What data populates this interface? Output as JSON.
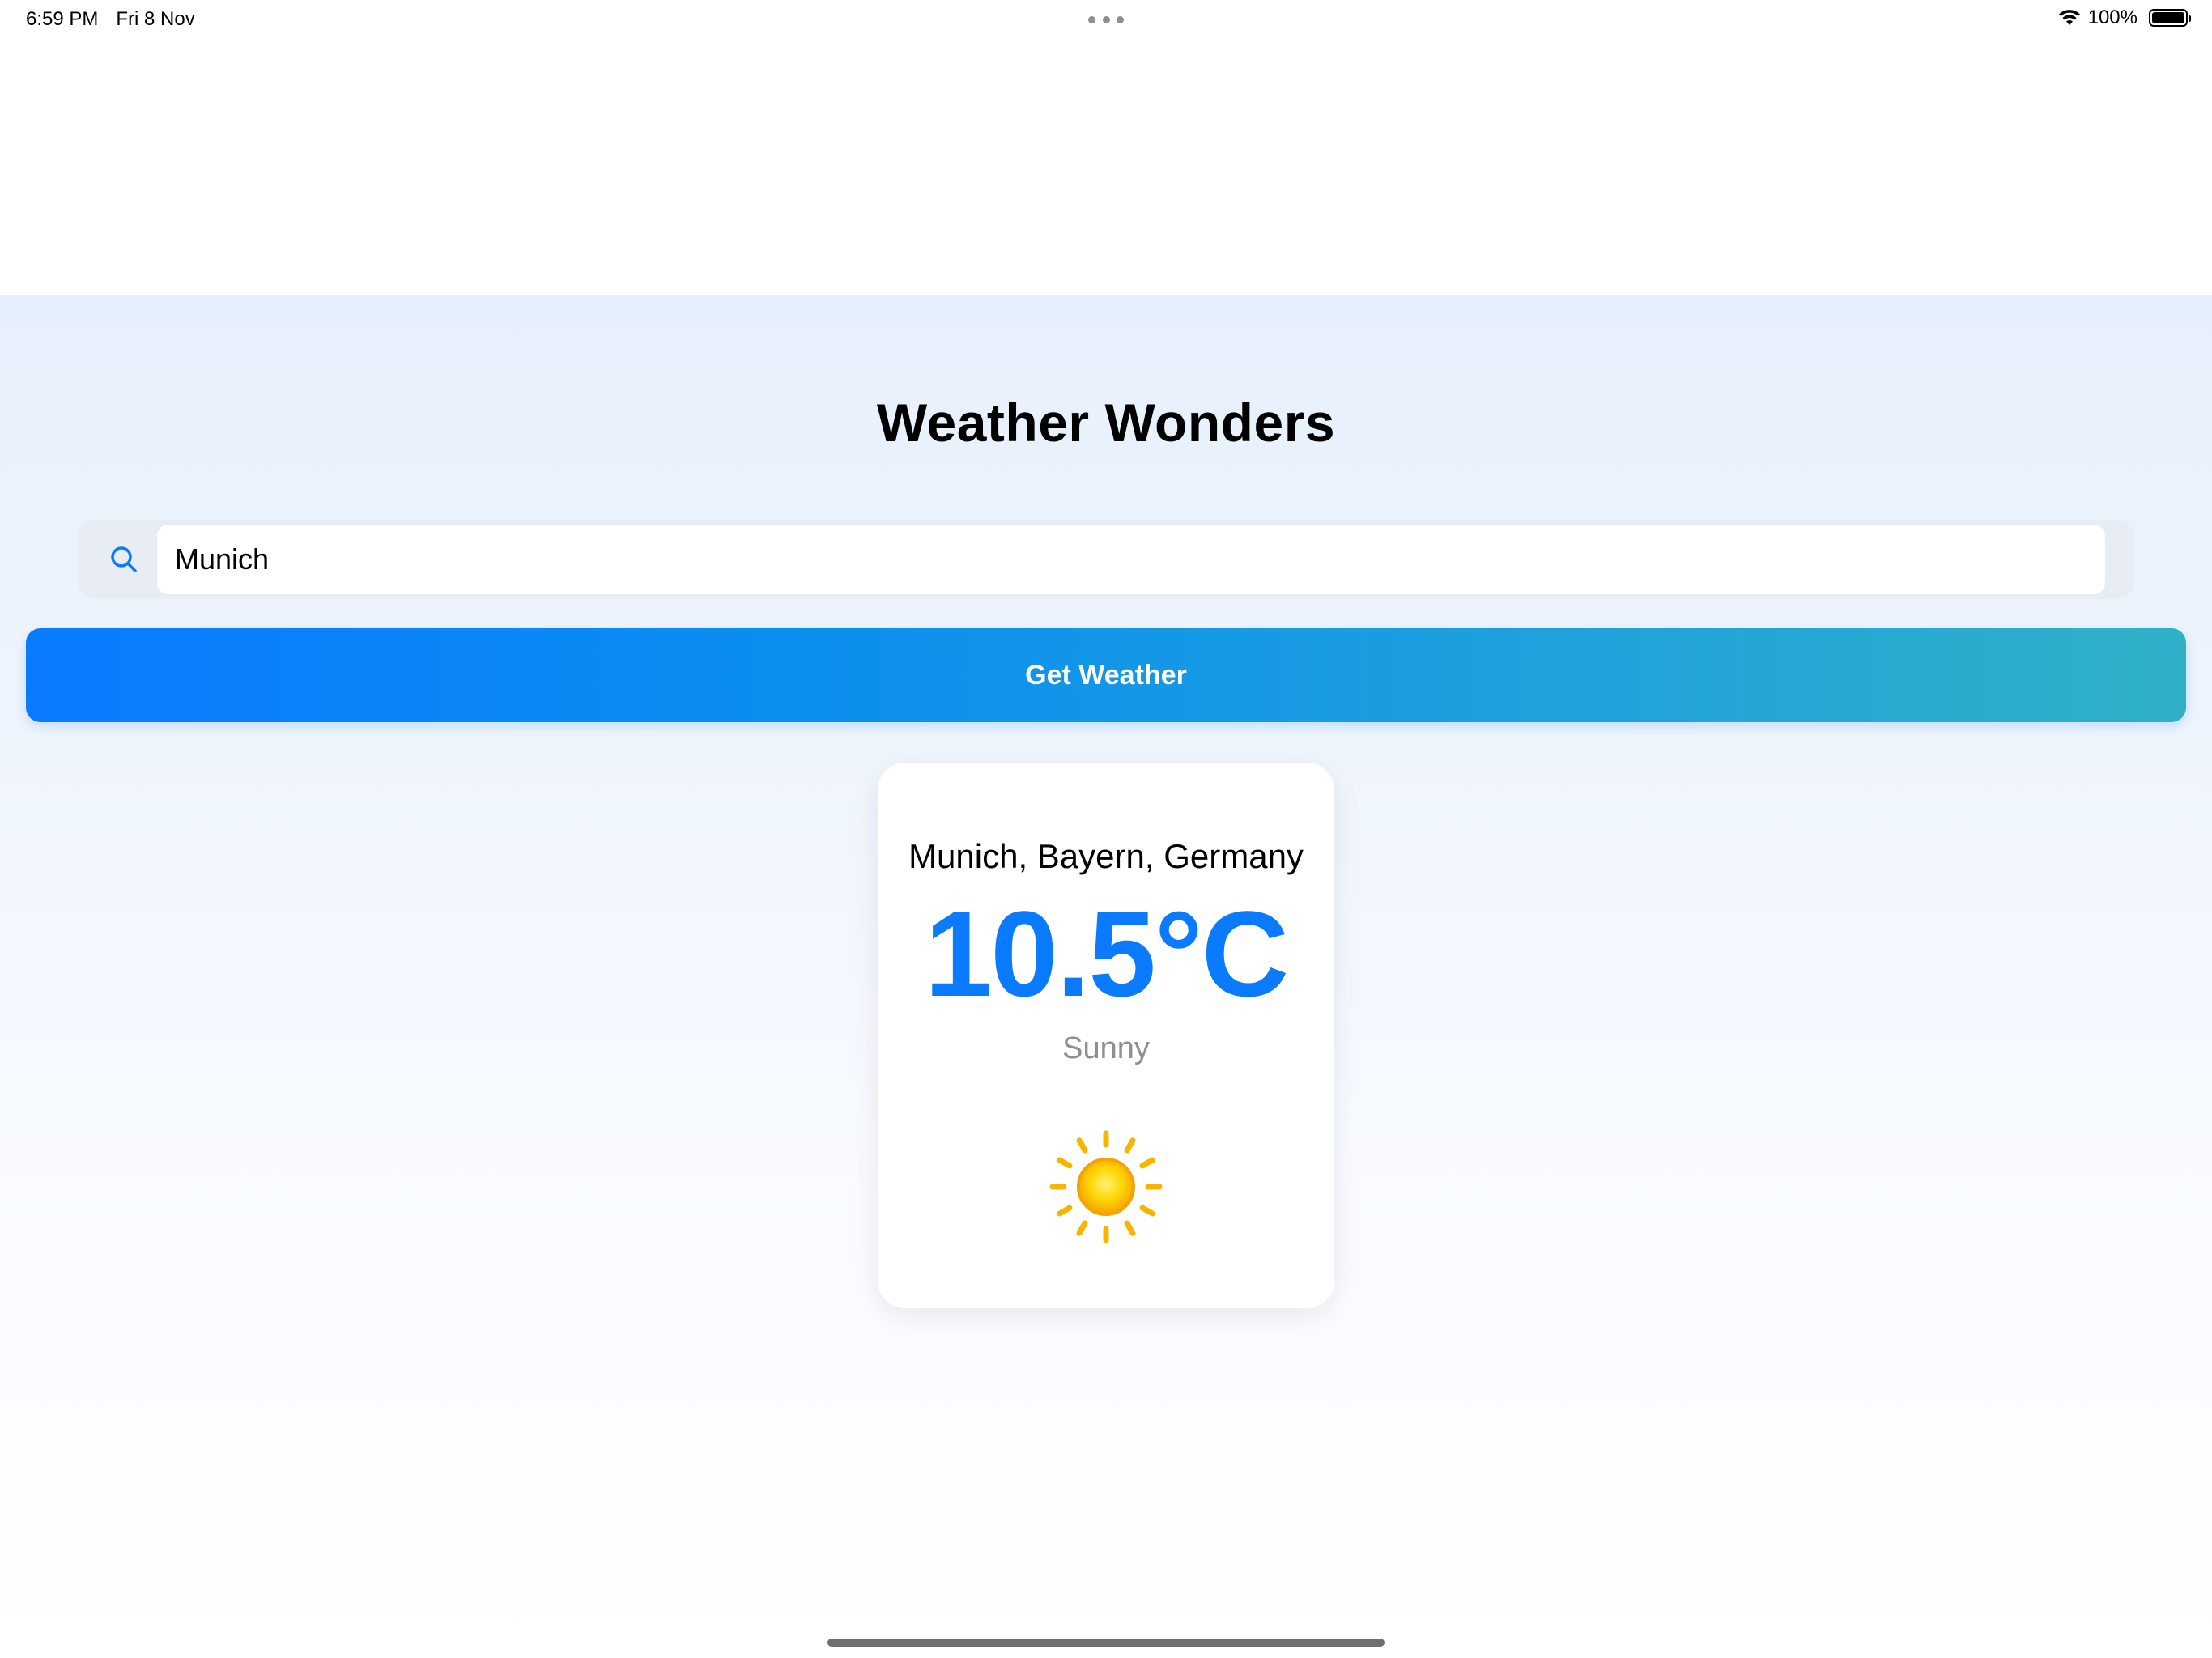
{
  "status_bar": {
    "time": "6:59 PM",
    "date": "Fri 8 Nov",
    "battery_percent": "100%",
    "battery_level": 1.0
  },
  "app": {
    "title": "Weather Wonders"
  },
  "search": {
    "value": "Munich",
    "placeholder": ""
  },
  "button": {
    "label": "Get Weather"
  },
  "weather": {
    "location": "Munich, Bayern, Germany",
    "temperature": "10.5°C",
    "condition": "Sunny",
    "icon": "sun-icon"
  },
  "colors": {
    "accent": "#0a7bff",
    "button_gradient_start": "#0a7bff",
    "button_gradient_end": "#30b0c7",
    "condition_text": "#8e8e93",
    "sun_yellow": "#ffd400",
    "sun_orange": "#f5a300"
  }
}
